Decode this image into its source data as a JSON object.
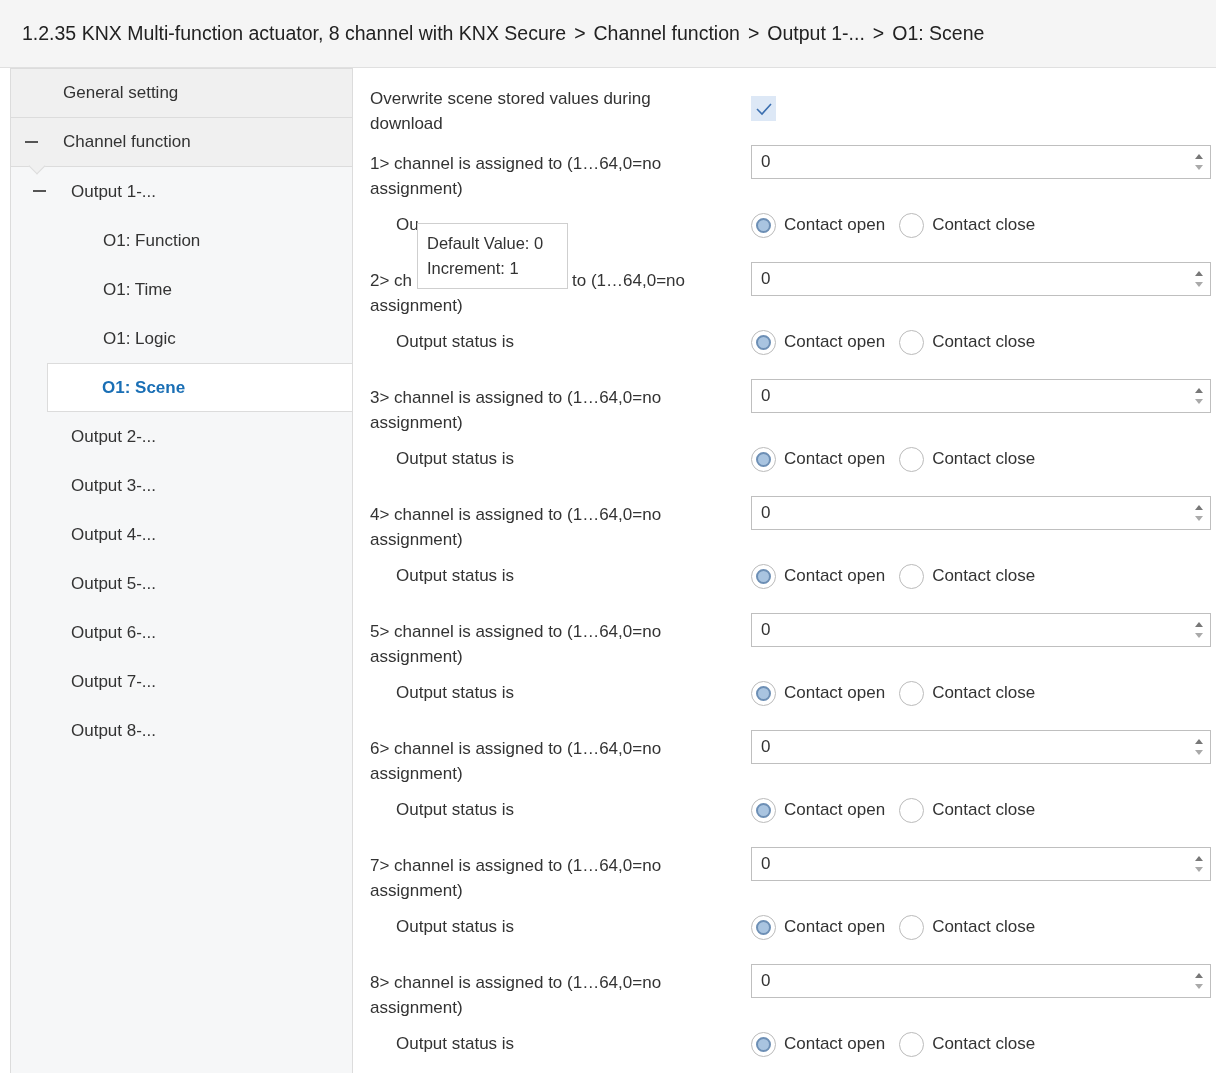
{
  "breadcrumb": [
    {
      "label": "1.2.35 KNX Multi-function actuator, 8 channel with KNX Secure"
    },
    {
      "label": "Channel function"
    },
    {
      "label": "Output 1-..."
    },
    {
      "label": "O1: Scene"
    }
  ],
  "breadcrumb_separator": ">",
  "sidebar": {
    "items": [
      {
        "label": "General setting",
        "selected": false
      },
      {
        "label": "Channel function",
        "selected": false,
        "expanded": true,
        "children": [
          {
            "label": "Output 1-...",
            "selected": false,
            "expanded": true,
            "children": [
              {
                "label": "O1: Function",
                "selected": false
              },
              {
                "label": "O1: Time",
                "selected": false
              },
              {
                "label": "O1: Logic",
                "selected": false
              },
              {
                "label": "O1: Scene",
                "selected": true
              }
            ]
          },
          {
            "label": "Output 2-...",
            "selected": false
          },
          {
            "label": "Output 3-...",
            "selected": false
          },
          {
            "label": "Output 4-...",
            "selected": false
          },
          {
            "label": "Output 5-...",
            "selected": false
          },
          {
            "label": "Output 6-...",
            "selected": false
          },
          {
            "label": "Output 7-...",
            "selected": false
          },
          {
            "label": "Output 8-...",
            "selected": false
          }
        ]
      }
    ]
  },
  "overwrite": {
    "label": "Overwrite scene stored values during download",
    "checked": true
  },
  "channels": [
    {
      "label_parts": [
        "1> channel is assigned to (1…64,0=no assignment)"
      ],
      "value": "0",
      "status_label": "Ou",
      "options": [
        {
          "label": "Contact open",
          "selected": true
        },
        {
          "label": "Contact close",
          "selected": false
        }
      ]
    },
    {
      "label_parts": [
        "2> ch",
        "to (1…64,0=no",
        "assignment)"
      ],
      "value": "0",
      "status_label": "Output status is",
      "options": [
        {
          "label": "Contact open",
          "selected": true
        },
        {
          "label": "Contact close",
          "selected": false
        }
      ]
    },
    {
      "label_parts": [
        "3> channel is assigned to (1…64,0=no assignment)"
      ],
      "value": "0",
      "status_label": "Output status is",
      "options": [
        {
          "label": "Contact open",
          "selected": true
        },
        {
          "label": "Contact close",
          "selected": false
        }
      ]
    },
    {
      "label_parts": [
        "4> channel is assigned to (1…64,0=no assignment)"
      ],
      "value": "0",
      "status_label": "Output status is",
      "options": [
        {
          "label": "Contact open",
          "selected": true
        },
        {
          "label": "Contact close",
          "selected": false
        }
      ]
    },
    {
      "label_parts": [
        "5> channel is assigned to (1…64,0=no assignment)"
      ],
      "value": "0",
      "status_label": "Output status is",
      "options": [
        {
          "label": "Contact open",
          "selected": true
        },
        {
          "label": "Contact close",
          "selected": false
        }
      ]
    },
    {
      "label_parts": [
        "6> channel is assigned to (1…64,0=no assignment)"
      ],
      "value": "0",
      "status_label": "Output status is",
      "options": [
        {
          "label": "Contact open",
          "selected": true
        },
        {
          "label": "Contact close",
          "selected": false
        }
      ]
    },
    {
      "label_parts": [
        "7> channel is assigned to (1…64,0=no assignment)"
      ],
      "value": "0",
      "status_label": "Output status is",
      "options": [
        {
          "label": "Contact open",
          "selected": true
        },
        {
          "label": "Contact close",
          "selected": false
        }
      ]
    },
    {
      "label_parts": [
        "8> channel is assigned to (1…64,0=no assignment)"
      ],
      "value": "0",
      "status_label": "Output status is",
      "options": [
        {
          "label": "Contact open",
          "selected": true
        },
        {
          "label": "Contact close",
          "selected": false
        }
      ]
    }
  ],
  "tooltip": {
    "lines": [
      "Default Value: 0",
      "Increment: 1"
    ]
  }
}
